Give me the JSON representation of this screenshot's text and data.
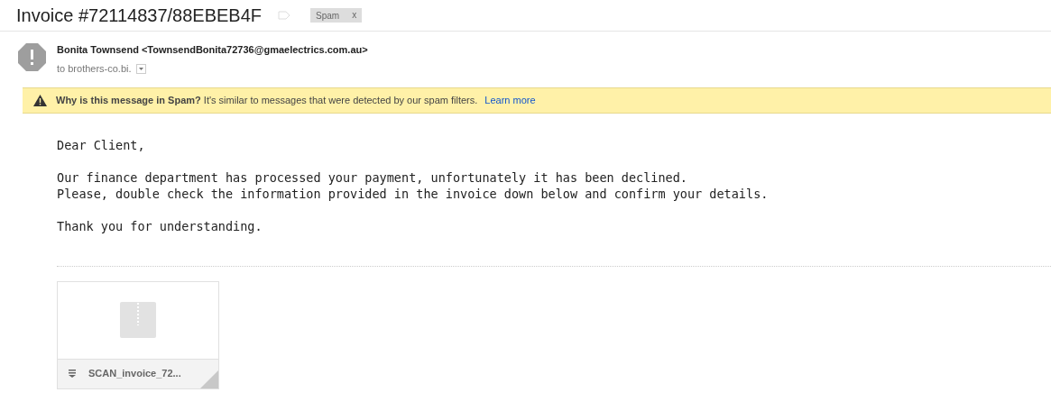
{
  "subject": "Invoice #72114837/88EBEB4F",
  "label": {
    "text": "Spam",
    "close": "x"
  },
  "sender": "Bonita Townsend <TownsendBonita72736@gmaelectrics.com.au>",
  "recipient": "to brothers-co.bi.",
  "spam_banner": {
    "text": "**Why is this message in Spam?** It's similar to messages that were detected by our spam filters.",
    "link": "Learn more"
  },
  "body": [
    [
      "Dear Client,"
    ],
    [
      "Our finance department has processed your payment, unfortunately it has been declined.",
      "Please, double check the information provided in the invoice down below and confirm your details."
    ],
    [
      "Thank you for understanding."
    ]
  ],
  "attachment": {
    "name": "SCAN_invoice_72..."
  }
}
